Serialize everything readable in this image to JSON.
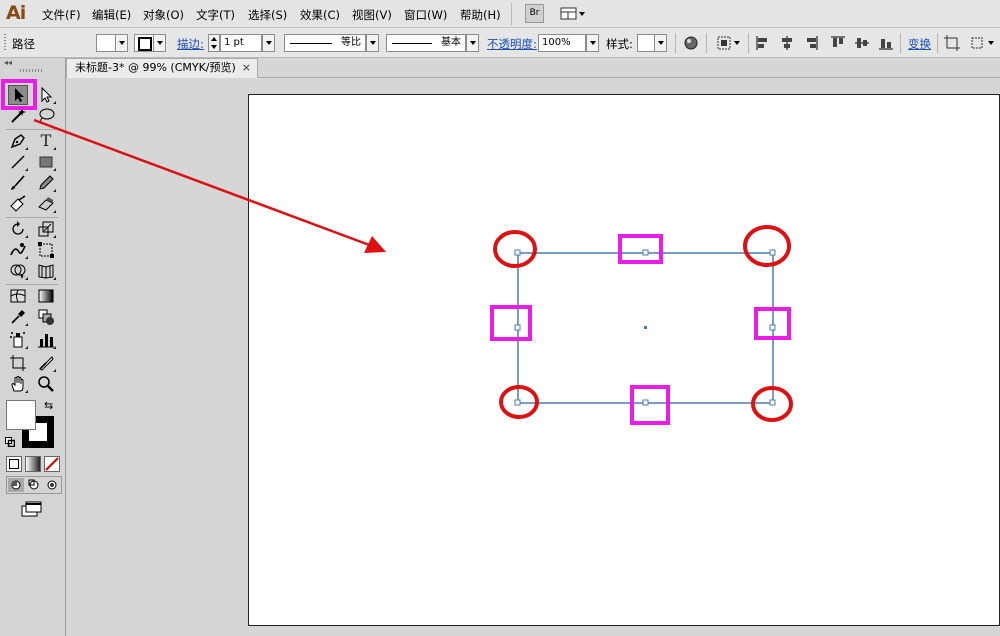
{
  "app": {
    "logo": "Ai"
  },
  "menu": {
    "items": [
      "文件(F)",
      "编辑(E)",
      "对象(O)",
      "文字(T)",
      "选择(S)",
      "效果(C)",
      "视图(V)",
      "窗口(W)",
      "帮助(H)"
    ],
    "bridge_label": "Br"
  },
  "control_bar": {
    "selection_label": "路径",
    "stroke_label": "描边:",
    "stroke_weight": "1 pt",
    "profile_label": "等比",
    "brush_label": "基本",
    "opacity_label": "不透明度:",
    "opacity_value": "100%",
    "style_label": "样式:",
    "transform_label": "变换"
  },
  "document": {
    "tab_title": "未标题-3* @ 99% (CMYK/预览)",
    "close_glyph": "×"
  },
  "tools": {
    "collapse_glyph": "◂◂"
  },
  "colors": {
    "annotation_magenta": "#e81ee8",
    "annotation_red": "#dd1111",
    "path_stroke": "#4a7bb0",
    "anchor_fill": "#ffffff"
  },
  "icons": {
    "selection": "selection-tool-icon",
    "direct_selection": "direct-selection-tool-icon",
    "magic_wand": "magic-wand-icon",
    "lasso": "lasso-icon",
    "pen": "pen-icon",
    "type": "type-icon",
    "line": "line-segment-icon",
    "rectangle": "rectangle-icon",
    "paintbrush": "paintbrush-icon",
    "pencil": "pencil-icon",
    "blob_brush": "blob-brush-icon",
    "eraser": "eraser-icon",
    "rotate": "rotate-icon",
    "scale": "scale-icon",
    "warp": "warp-icon",
    "free_transform": "free-transform-icon",
    "shape_builder": "shape-builder-icon",
    "perspective_grid": "perspective-grid-icon",
    "mesh": "mesh-icon",
    "gradient": "gradient-icon",
    "eyedropper": "eyedropper-icon",
    "blend": "blend-icon",
    "symbol_sprayer": "symbol-sprayer-icon",
    "column_graph": "column-graph-icon",
    "artboard": "artboard-icon",
    "slice": "slice-icon",
    "hand": "hand-icon",
    "zoom": "zoom-icon"
  }
}
